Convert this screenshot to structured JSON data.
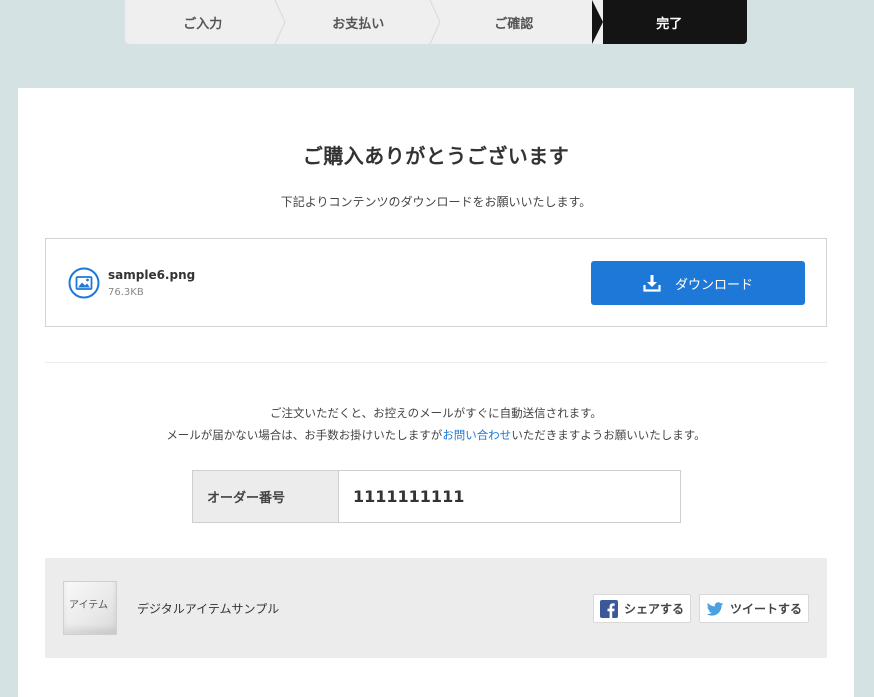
{
  "steps": [
    {
      "label": "ご入力",
      "active": false
    },
    {
      "label": "お支払い",
      "active": false
    },
    {
      "label": "ご確認",
      "active": false
    },
    {
      "label": "完了",
      "active": true
    }
  ],
  "main": {
    "title": "ご購入ありがとうございます",
    "subtitle": "下記よりコンテンツのダウンロードをお願いいたします。"
  },
  "file": {
    "icon": "image-icon",
    "name": "sample6.png",
    "size": "76.3KB",
    "download_label": "ダウンロード"
  },
  "notice": {
    "line1": "ご注文いただくと、お控えのメールがすぐに自動送信されます。",
    "line2_before": "メールが届かない場合は、お手数お掛けいたしますが",
    "line2_link": "お問い合わせ",
    "line2_after": "いただきますようお願いいたします。"
  },
  "order": {
    "label": "オーダー番号",
    "number": "1111111111"
  },
  "product": {
    "thumb_label": "アイテム",
    "name": "デジタルアイテムサンプル",
    "share_label": "シェアする",
    "tweet_label": "ツイートする"
  },
  "colors": {
    "background": "#d5e2e3",
    "accent": "#1e78d7",
    "step_active": "#141414",
    "facebook": "#3b5998",
    "twitter": "#4ba0e2"
  }
}
